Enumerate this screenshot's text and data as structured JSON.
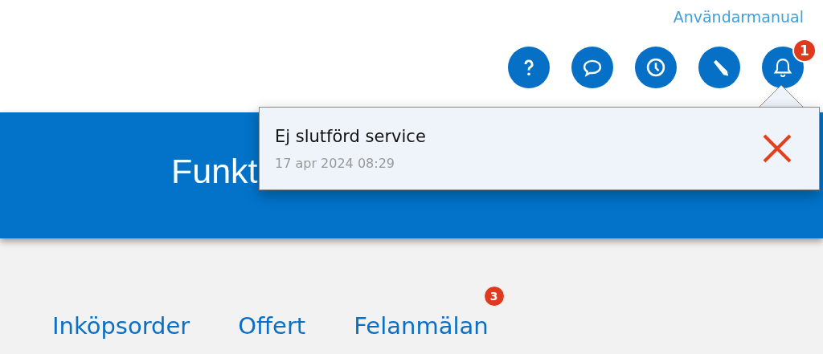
{
  "header": {
    "manual_link": "Användarmanual",
    "toolbar": [
      {
        "kind": "help"
      },
      {
        "kind": "chat"
      },
      {
        "kind": "history"
      },
      {
        "kind": "edit"
      },
      {
        "kind": "notifications",
        "badge": "1"
      }
    ]
  },
  "banner": {
    "title": "Funkt"
  },
  "notification_popup": {
    "title": "Ej slutförd service",
    "time": "17 apr 2024 08:29"
  },
  "tabs": [
    {
      "label": "Inköpsorder"
    },
    {
      "label": "Offert"
    },
    {
      "label": "Felanmälan",
      "badge": "3"
    }
  ]
}
